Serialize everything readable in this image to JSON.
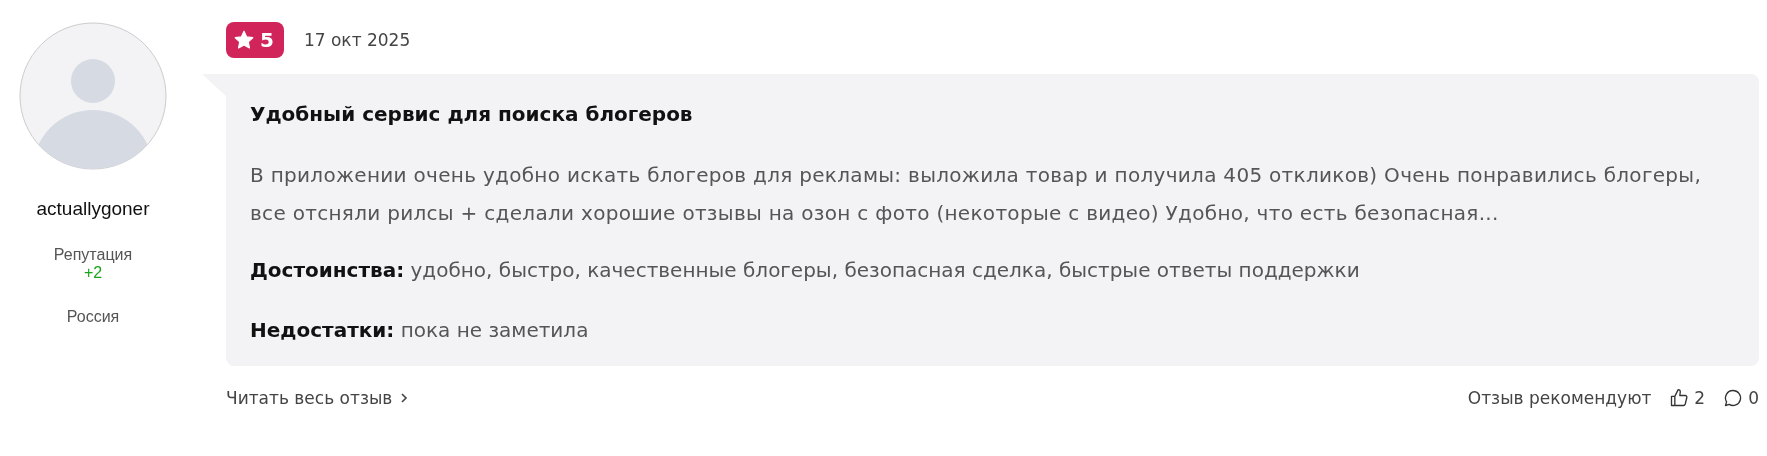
{
  "author": {
    "username": "actuallygoner",
    "reputation_label": "Репутация",
    "reputation_value": "+2",
    "country": "Россия"
  },
  "review": {
    "rating": "5",
    "date": "17 окт 2025",
    "title": "Удобный сервис для поиска блогеров",
    "body": "В приложении очень удобно искать блогеров для рекламы: выложила товар и получила 405 откликов) Очень понравились блогеры, все отсняли рилсы + сделали хорошие отзывы на озон с фото (некоторые с видео) Удобно, что есть безопасная...",
    "pros": "**Достоинства:** удобно, быстро, качественные блогеры, безопасная сделка, быстрые ответы поддержки",
    "cons": "**Недостатки:** пока не заметила"
  },
  "footer": {
    "read_more": "Читать весь отзыв",
    "recommend_label": "Отзыв рекомендуют",
    "likes": "2",
    "comments": "0"
  }
}
